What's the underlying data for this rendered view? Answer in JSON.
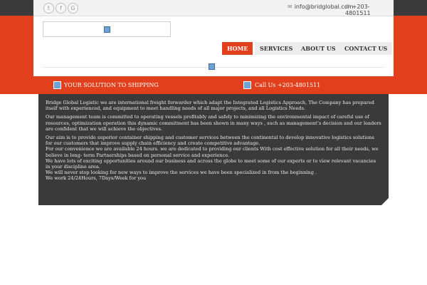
{
  "header": {
    "social": [
      {
        "icon": "twitter-icon",
        "glyph": "t"
      },
      {
        "icon": "facebook-icon",
        "glyph": "f"
      },
      {
        "icon": "google-icon",
        "glyph": "G"
      }
    ],
    "email": "info@bridglobal.com",
    "phone": "+203-4801511"
  },
  "nav": {
    "items": [
      "HOME",
      "SERVICES",
      "ABOUT US",
      "CONTACT US"
    ],
    "active": "HOME"
  },
  "bar": {
    "tagline": "YOUR SOLUTION TO SHIPPING",
    "call": "Call Us +203-4801511"
  },
  "content": {
    "paragraphs": [
      "Bridge Global Logistic we are international freight forwarder which adapt the Integrated Logistics Approach, The Company has prepared itself with experienced, and equipment to meet handling needs of all major projects, and all Logistics Needs.",
      "Our management team is committed to operating vessels profitably and safely to minimizing the environmental impact of careful use of resources, optimization operation  this dynamic commitment has been shown in many ways , such as management’s decision and our leaders are confident that we will achieve the objectives.",
      "Our aim is to provide superior container shipping and customer services between the continental to develop innovative logistics solutions for our customers that improve supply chain efficiency and create competitive advantage.",
      "For our convenience we are available 24 hours. we are dedicated to providing our clients With cost effective solution for all their needs, we believe in long- term Partnerships based on personal service and experience.",
      "We have lots of exciting opportunities around our business and across the globe to meet some of our experts or to view relevant vacancies in your discipline area.",
      "We will never stop looking for new ways to improve the services we have been specialized in from the beginning .",
      "We work 24/24Hours, 7Days/Week for you"
    ]
  },
  "colors": {
    "accent": "#e2401c",
    "dark": "#3a3a3a"
  }
}
